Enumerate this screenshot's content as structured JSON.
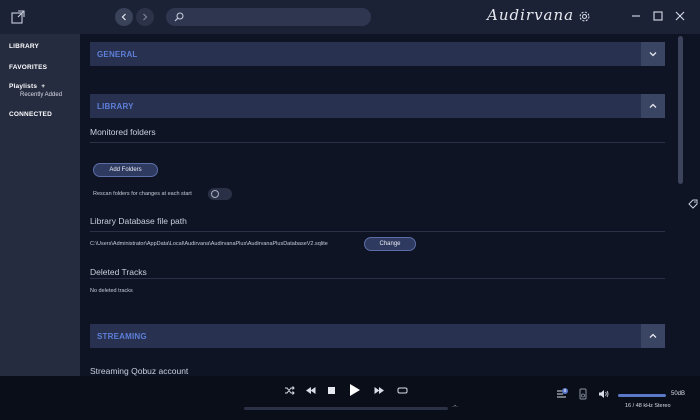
{
  "app": {
    "brand": "Audirvana"
  },
  "search": {
    "placeholder": ""
  },
  "sidebar": {
    "library": "LIBRARY",
    "favorites": "FAVORITES",
    "playlists": "Playlists",
    "playlists_add": "+",
    "recently_added": "Recently Added",
    "connected": "CONNECTED"
  },
  "general": {
    "title": "GENERAL"
  },
  "library": {
    "title": "LIBRARY",
    "monitored_folders": "Monitored folders",
    "add_folders": "Add Folders",
    "rescan_label": "Rescan folders for changes at each start",
    "rescan_enabled": false,
    "db_path_title": "Library Database file path",
    "db_path": "C:\\Users\\Administrator\\AppData\\Local\\Audirvana\\AudirvanaPlus\\AudirvanaPlusDatabaseV2.sqlite",
    "change": "Change",
    "deleted_tracks_title": "Deleted Tracks",
    "no_deleted": "No deleted tracks"
  },
  "streaming": {
    "title": "STREAMING",
    "qobuz_account": "Streaming Qobuz account"
  },
  "player": {
    "volume": "50dB",
    "format": "16 / 48 kHz Stereo",
    "queue_count": "0",
    "progress": 0
  },
  "colors": {
    "accent": "#5d7fd8",
    "section_bg": "#283150",
    "sidebar_bg": "#262c40",
    "main_bg": "#0f1424"
  },
  "icons": [
    "new-window-icon",
    "back-icon",
    "forward-icon",
    "search-icon",
    "gear-icon",
    "minimize-icon",
    "maximize-icon",
    "close-icon",
    "chevron-down-icon",
    "chevron-up-icon",
    "tag-icon",
    "shuffle-icon",
    "previous-icon",
    "stop-icon",
    "play-icon",
    "next-icon",
    "repeat-icon",
    "queue-icon",
    "device-icon",
    "volume-icon"
  ]
}
